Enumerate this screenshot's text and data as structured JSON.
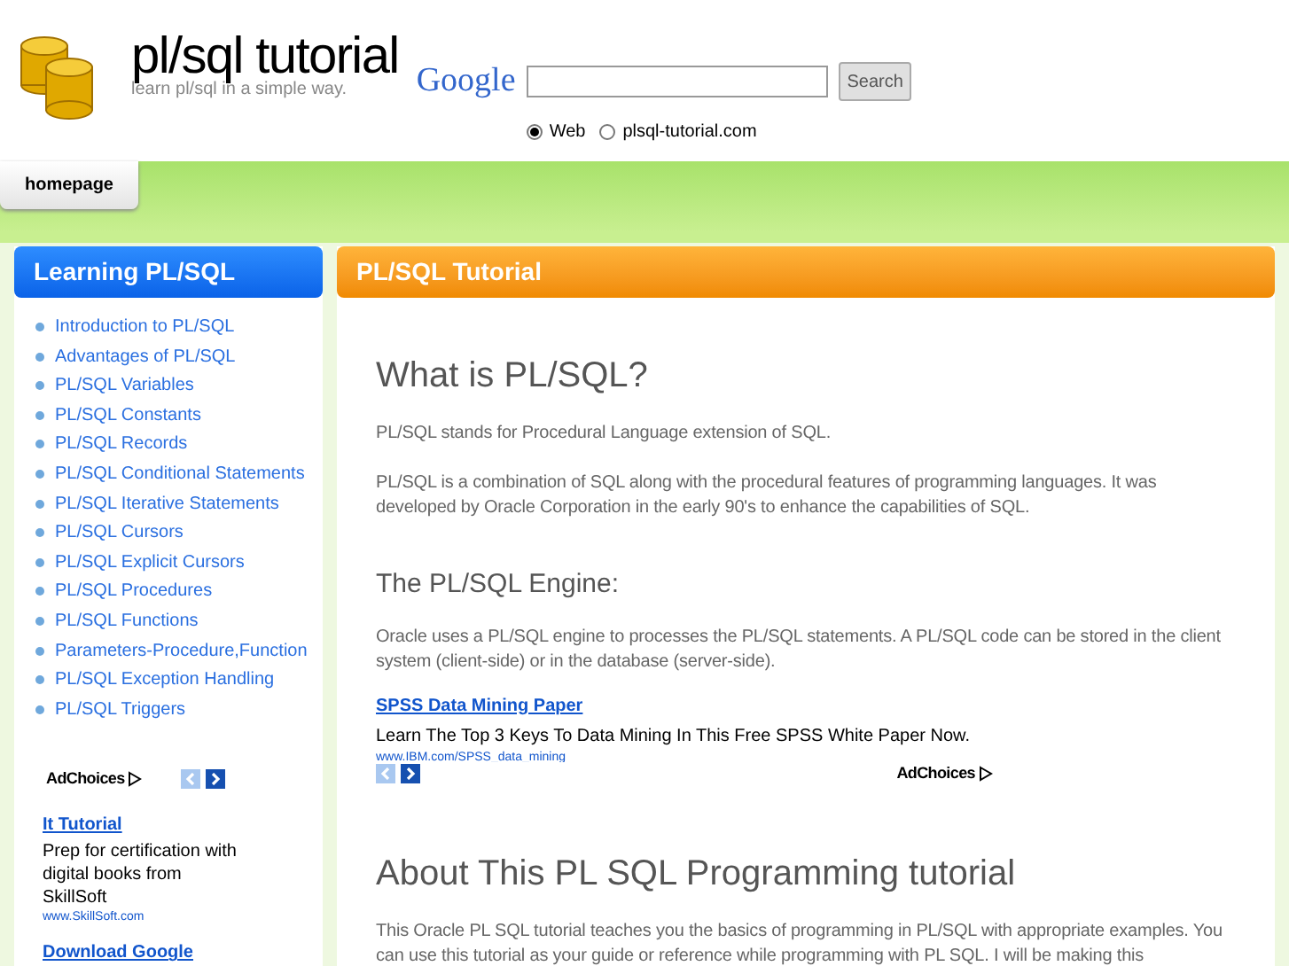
{
  "header": {
    "title": "pl/sql tutorial",
    "tagline": "learn pl/sql in a simple way.",
    "search_logo": "Google",
    "search_button": "Search",
    "scopes": [
      {
        "label": "Web",
        "selected": true
      },
      {
        "label": "plsql-tutorial.com",
        "selected": false
      }
    ]
  },
  "nav": [
    {
      "label": "homepage",
      "selected": true
    }
  ],
  "sidebar": {
    "title": "Learning PL/SQL",
    "items": [
      "Introduction to PL/SQL",
      "Advantages of PL/SQL",
      "PL/SQL Variables",
      "PL/SQL Constants",
      "PL/SQL Records",
      "PL/SQL Conditional Statements",
      "PL/SQL Iterative Statements",
      "PL/SQL Cursors",
      "PL/SQL Explicit Cursors",
      "PL/SQL Procedures",
      "PL/SQL Functions",
      "Parameters-Procedure,Function",
      "PL/SQL Exception Handling",
      "PL/SQL Triggers"
    ],
    "ad": {
      "adchoices": "AdChoices",
      "title": "It Tutorial",
      "text": "Prep for certification with digital books from SkillSoft",
      "url": "www.SkillSoft.com",
      "next_title": "Download Google"
    }
  },
  "content": {
    "title": "PL/SQL Tutorial",
    "blocks": [
      {
        "kind": "h1",
        "text": "What is PL/SQL?"
      },
      {
        "kind": "p",
        "text": "PL/SQL stands for Procedural Language extension of SQL."
      },
      {
        "kind": "p",
        "text": "PL/SQL is a combination of SQL along with the procedural features of programming languages. It was developed by Oracle Corporation in the early 90's to enhance the capabilities of SQL."
      },
      {
        "kind": "h2",
        "text": "The PL/SQL Engine:"
      },
      {
        "kind": "p",
        "text": "Oracle uses a PL/SQL engine to processes the PL/SQL statements. A PL/SQL code can be stored in the client system (client-side) or in the database (server-side)."
      },
      {
        "kind": "ad",
        "title": "SPSS Data Mining Paper",
        "text": "Learn The Top 3 Keys To Data Mining In This Free SPSS White Paper Now.",
        "url": "www.IBM.com/SPSS_data_mining",
        "adchoices": "AdChoices"
      },
      {
        "kind": "h1",
        "text": "About This PL SQL Programming tutorial"
      },
      {
        "kind": "p",
        "text": "This Oracle PL SQL tutorial teaches you the basics of programming in PL/SQL with appropriate examples. You can use this tutorial as your guide or reference while programming with PL SQL. I will be making this"
      }
    ]
  }
}
